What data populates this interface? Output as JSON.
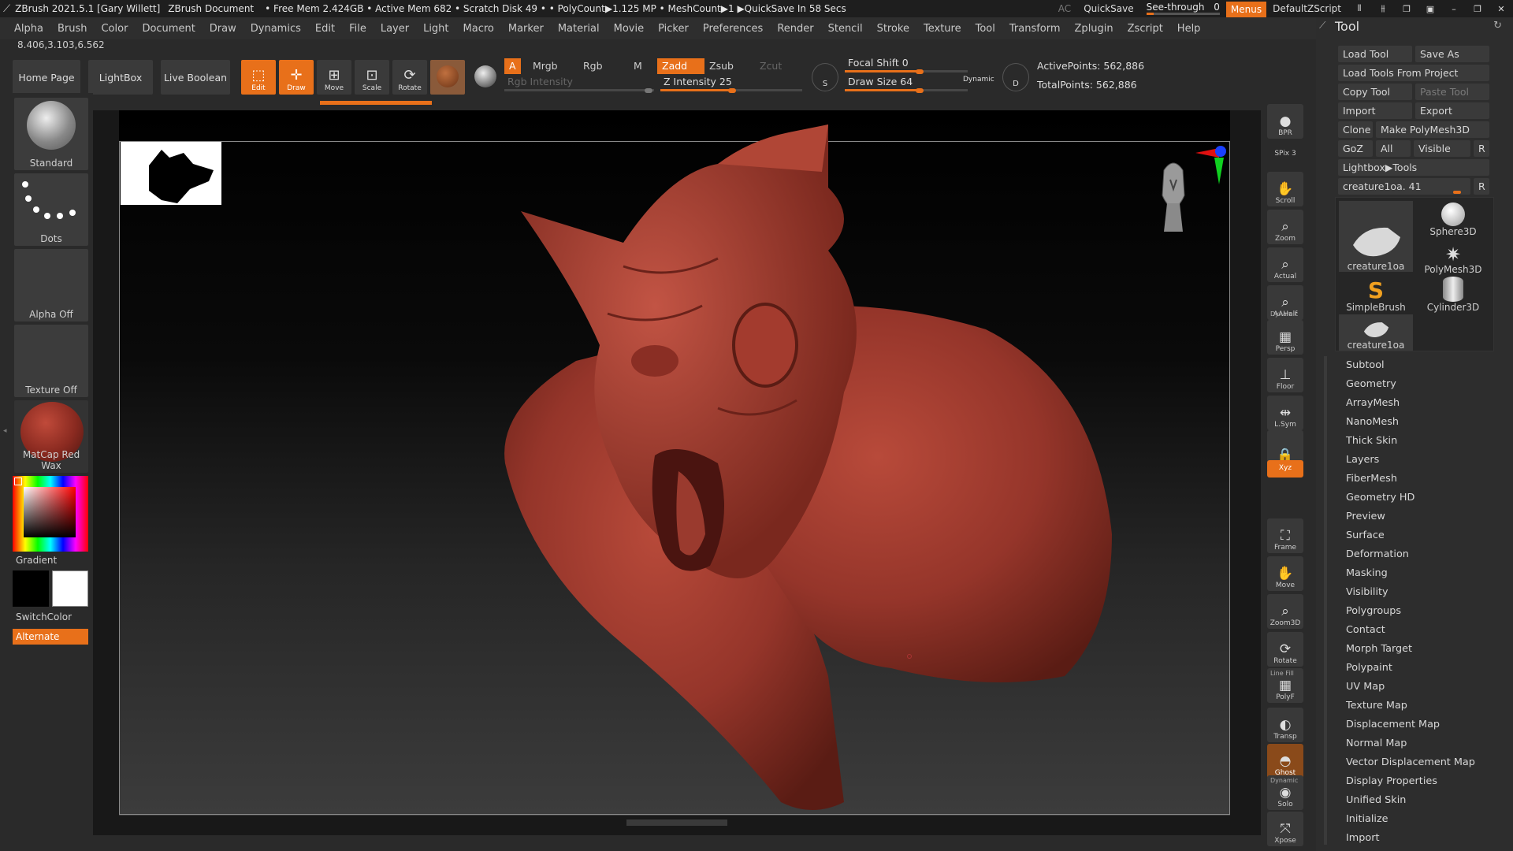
{
  "titlebar": {
    "app": "ZBrush 2021.5.1 [Gary Willett]",
    "document": "ZBrush Document",
    "stats": "• Free Mem 2.424GB • Active Mem 682 • Scratch Disk 49 • • PolyCount▶1.125 MP • MeshCount▶1 ▶QuickSave In 58 Secs",
    "ac": "AC",
    "quicksave": "QuickSave",
    "see_through_label": "See-through",
    "see_through_value": "0",
    "menus": "Menus",
    "zscript": "DefaultZScript"
  },
  "menubar": [
    "Alpha",
    "Brush",
    "Color",
    "Document",
    "Draw",
    "Dynamics",
    "Edit",
    "File",
    "Layer",
    "Light",
    "Macro",
    "Marker",
    "Material",
    "Movie",
    "Picker",
    "Preferences",
    "Render",
    "Stencil",
    "Stroke",
    "Texture",
    "Tool",
    "Transform",
    "Zplugin",
    "Zscript",
    "Help"
  ],
  "coords": "8.406,3.103,6.562",
  "shelf": {
    "home_page": "Home Page",
    "lightbox": "LightBox",
    "live_boolean": "Live Boolean",
    "edit": "Edit",
    "draw": "Draw",
    "move": "Move",
    "scale": "Scale",
    "rotate": "Rotate",
    "a": "A",
    "mrgb": "Mrgb",
    "rgb": "Rgb",
    "m": "M",
    "zadd": "Zadd",
    "zsub": "Zsub",
    "zcut": "Zcut",
    "rgb_intensity": "Rgb Intensity",
    "z_intensity": "Z Intensity 25",
    "focal_shift": "Focal Shift 0",
    "draw_size": "Draw Size 64",
    "dynamic": "Dynamic",
    "active_points": "ActivePoints: 562,886",
    "total_points": "TotalPoints: 562,886",
    "s": "S",
    "d": "D"
  },
  "left_tray": {
    "brush": "Standard",
    "stroke": "Dots",
    "alpha": "Alpha Off",
    "texture": "Texture Off",
    "material": "MatCap Red Wax",
    "gradient": "Gradient",
    "switch_color": "SwitchColor",
    "alternate": "Alternate"
  },
  "right_shelf": [
    {
      "key": "bpr",
      "label": "BPR",
      "icon": "bpr-icon"
    },
    {
      "key": "spix",
      "label": "SPix 3",
      "icon": ""
    },
    {
      "key": "scroll",
      "label": "Scroll",
      "icon": "hand-icon"
    },
    {
      "key": "zoom",
      "label": "Zoom",
      "icon": "magnifier-icon"
    },
    {
      "key": "actual",
      "label": "Actual",
      "icon": "magnifier-icon"
    },
    {
      "key": "aahalf",
      "label": "AAHalf",
      "icon": "magnifier-icon"
    },
    {
      "key": "persp",
      "label": "Persp",
      "icon": "grid-icon"
    },
    {
      "key": "floor",
      "label": "Floor",
      "icon": "floor-icon"
    },
    {
      "key": "lsym",
      "label": "L.Sym",
      "icon": "sym-icon"
    },
    {
      "key": "lock",
      "label": "",
      "icon": "lock-icon"
    },
    {
      "key": "xyz",
      "label": "Xyz",
      "icon": "xyz-icon"
    },
    {
      "key": "frame",
      "label": "Frame",
      "icon": "frame-icon"
    },
    {
      "key": "move",
      "label": "Move",
      "icon": "hand-icon"
    },
    {
      "key": "zoom3d",
      "label": "Zoom3D",
      "icon": "magnifier-icon"
    },
    {
      "key": "rotate",
      "label": "Rotate",
      "icon": "rotate-icon"
    },
    {
      "key": "polyf",
      "label": "PolyF",
      "icon": "grid-icon"
    },
    {
      "key": "transp",
      "label": "Transp",
      "icon": "transp-icon"
    },
    {
      "key": "ghost",
      "label": "Ghost",
      "icon": "ghost-icon"
    },
    {
      "key": "solo",
      "label": "Solo",
      "icon": "solo-icon"
    },
    {
      "key": "xpose",
      "label": "Xpose",
      "icon": "xpose-icon"
    }
  ],
  "right_shelf_extra": {
    "dynamic": "Dynamic",
    "line_fill": "Line Fill"
  },
  "tool_panel": {
    "title": "Tool",
    "load_tool": "Load Tool",
    "save_as": "Save As",
    "load_from_project": "Load Tools From Project",
    "copy_tool": "Copy Tool",
    "paste_tool": "Paste Tool",
    "import": "Import",
    "export": "Export",
    "clone": "Clone",
    "make_polymesh": "Make PolyMesh3D",
    "goz": "GoZ",
    "all": "All",
    "visible": "Visible",
    "r": "R",
    "lightbox_tools": "Lightbox▶Tools",
    "current_tool": "creature1oa. 41",
    "thumbs": [
      "creature1oa",
      "Sphere3D",
      "PolyMesh3D",
      "SimpleBrush",
      "Cylinder3D",
      "creature1oa"
    ],
    "sections": [
      "Subtool",
      "Geometry",
      "ArrayMesh",
      "NanoMesh",
      "Thick Skin",
      "Layers",
      "FiberMesh",
      "Geometry HD",
      "Preview",
      "Surface",
      "Deformation",
      "Masking",
      "Visibility",
      "Polygroups",
      "Contact",
      "Morph Target",
      "Polypaint",
      "UV Map",
      "Texture Map",
      "Displacement Map",
      "Normal Map",
      "Vector Displacement Map",
      "Display Properties",
      "Unified Skin",
      "Initialize",
      "Import"
    ]
  },
  "colors": {
    "accent": "#e8701a",
    "clay": "#9c3c30"
  }
}
